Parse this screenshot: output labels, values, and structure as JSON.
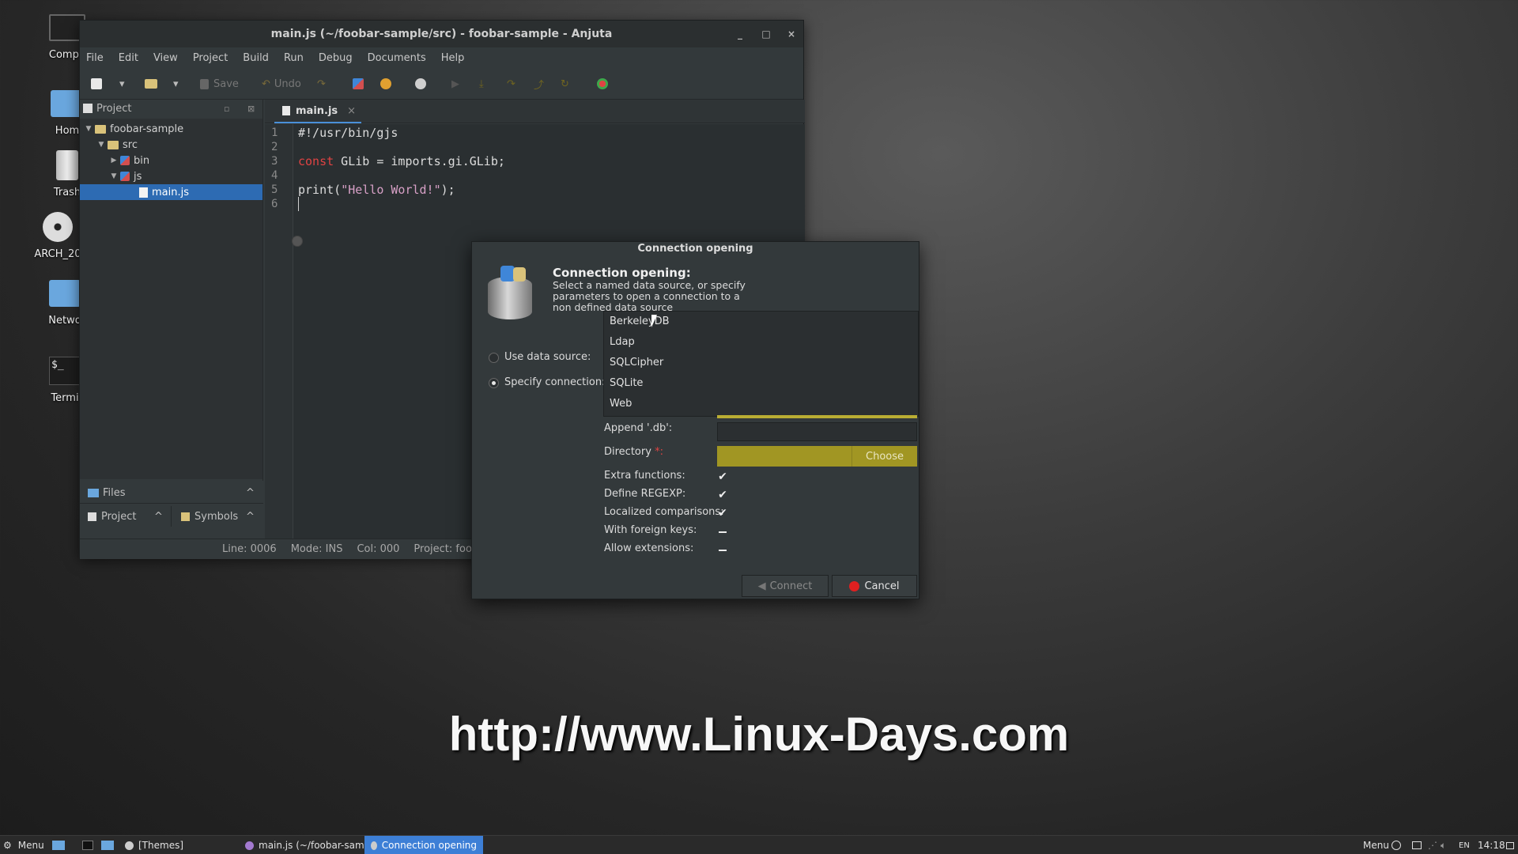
{
  "desktop": {
    "icons": [
      {
        "label": "Compu",
        "icon": "computer-icon"
      },
      {
        "label": "Hom",
        "icon": "home-folder-icon"
      },
      {
        "label": "Trash",
        "icon": "trash-icon"
      },
      {
        "label": "ARCH_20",
        "icon": "disc-icon"
      },
      {
        "label": "Netwo",
        "icon": "network-icon"
      },
      {
        "label": "Termi",
        "icon": "terminal-icon"
      }
    ],
    "terminal_glyph": "$_",
    "watermark": "http://www.Linux-Days.com"
  },
  "window": {
    "title": "main.js (~/foobar-sample/src) - foobar-sample - Anjuta",
    "controls": {
      "minimize": "_",
      "maximize": "□",
      "close": "×"
    },
    "menu": [
      "File",
      "Edit",
      "View",
      "Project",
      "Build",
      "Run",
      "Debug",
      "Documents",
      "Help"
    ],
    "toolbar": {
      "save": "Save",
      "undo": "Undo"
    },
    "project_panel": {
      "title": "Project",
      "tree": [
        {
          "label": "foobar-sample",
          "type": "folder",
          "depth": 0
        },
        {
          "label": "src",
          "type": "folder",
          "depth": 1
        },
        {
          "label": "bin",
          "type": "package",
          "depth": 2
        },
        {
          "label": "js",
          "type": "package",
          "depth": 2
        },
        {
          "label": "main.js",
          "type": "file",
          "depth": 3
        }
      ]
    },
    "bottom_panels": {
      "files": "Files",
      "project": "Project",
      "symbols": "Symbols"
    },
    "statusbar": {
      "line": "Line: 0006",
      "mode": "Mode: INS",
      "col": "Col: 000",
      "project": "Project: foobar-"
    },
    "editor": {
      "tab": "main.js",
      "line_numbers": [
        "1",
        "2",
        "3",
        "4",
        "5",
        "6"
      ],
      "lines": [
        {
          "plain": "#!/usr/bin/gjs"
        },
        {
          "plain": ""
        },
        {
          "keyword": "const",
          "plain": " GLib = imports.gi.GLib;"
        },
        {
          "plain": ""
        },
        {
          "pre": "print(",
          "string": "\"Hello World!\"",
          "post": ");"
        },
        {
          "plain": ""
        }
      ]
    }
  },
  "dialog": {
    "title": "Connection opening",
    "heading": "Connection opening:",
    "desc_lines": [
      "Select a named data source, or specify",
      "parameters to open a connection to a",
      "non defined data source"
    ],
    "use_data_source": "Use data source:",
    "specify_connection": "Specify connection:",
    "providers": [
      "BerkeleyDB",
      "Ldap",
      "SQLCipher",
      "SQLite",
      "Web"
    ],
    "fields": {
      "append_db": "Append '.db':",
      "directory": "Directory",
      "required_mark": "*:",
      "choose": "Choose",
      "extra_functions": "Extra functions:",
      "define_regexp": "Define REGEXP:",
      "localized_comparisons": "Localized comparisons:",
      "with_foreign_keys": "With foreign keys:",
      "allow_extensions": "Allow extensions:"
    },
    "check_glyph": "✔",
    "buttons": {
      "connect": "Connect",
      "cancel": "Cancel"
    }
  },
  "taskbar": {
    "menu": "Menu",
    "themes": "[Themes]",
    "anjuta_task": "main.js (~/foobar-samp...",
    "dialog_task": "Connection opening",
    "right_menu": "Menu",
    "lang": "EN",
    "clock": "14:18"
  },
  "colors": {
    "accent": "#2d6bb3",
    "keyword": "#e04343",
    "string": "#d7a0c6",
    "required_field": "#a19623",
    "cancel_red": "#e02020"
  }
}
